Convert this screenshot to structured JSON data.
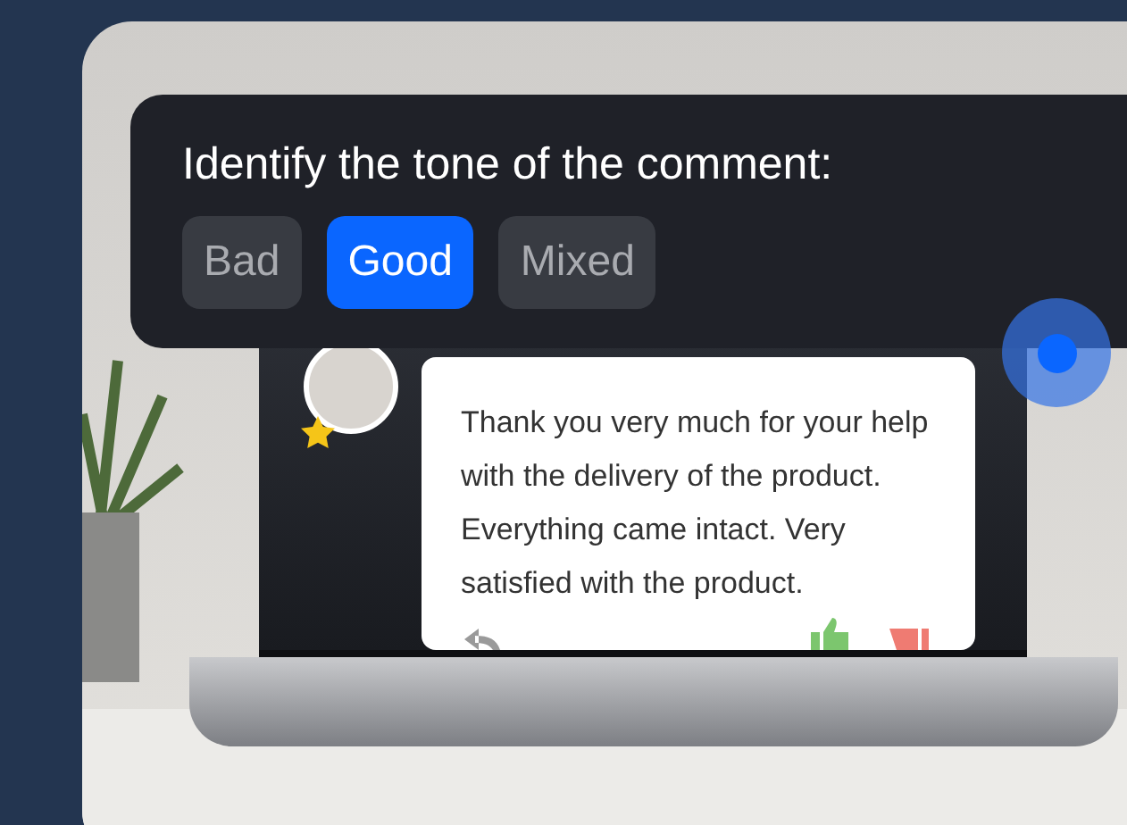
{
  "question": {
    "title": "Identify the tone of the comment:",
    "options": [
      {
        "label": "Bad",
        "selected": false
      },
      {
        "label": "Good",
        "selected": true
      },
      {
        "label": "Mixed",
        "selected": false
      }
    ]
  },
  "comment": {
    "text": "Thank you very much for your help with the delivery of the product. Everything came intact. Very satisfied with the product."
  }
}
